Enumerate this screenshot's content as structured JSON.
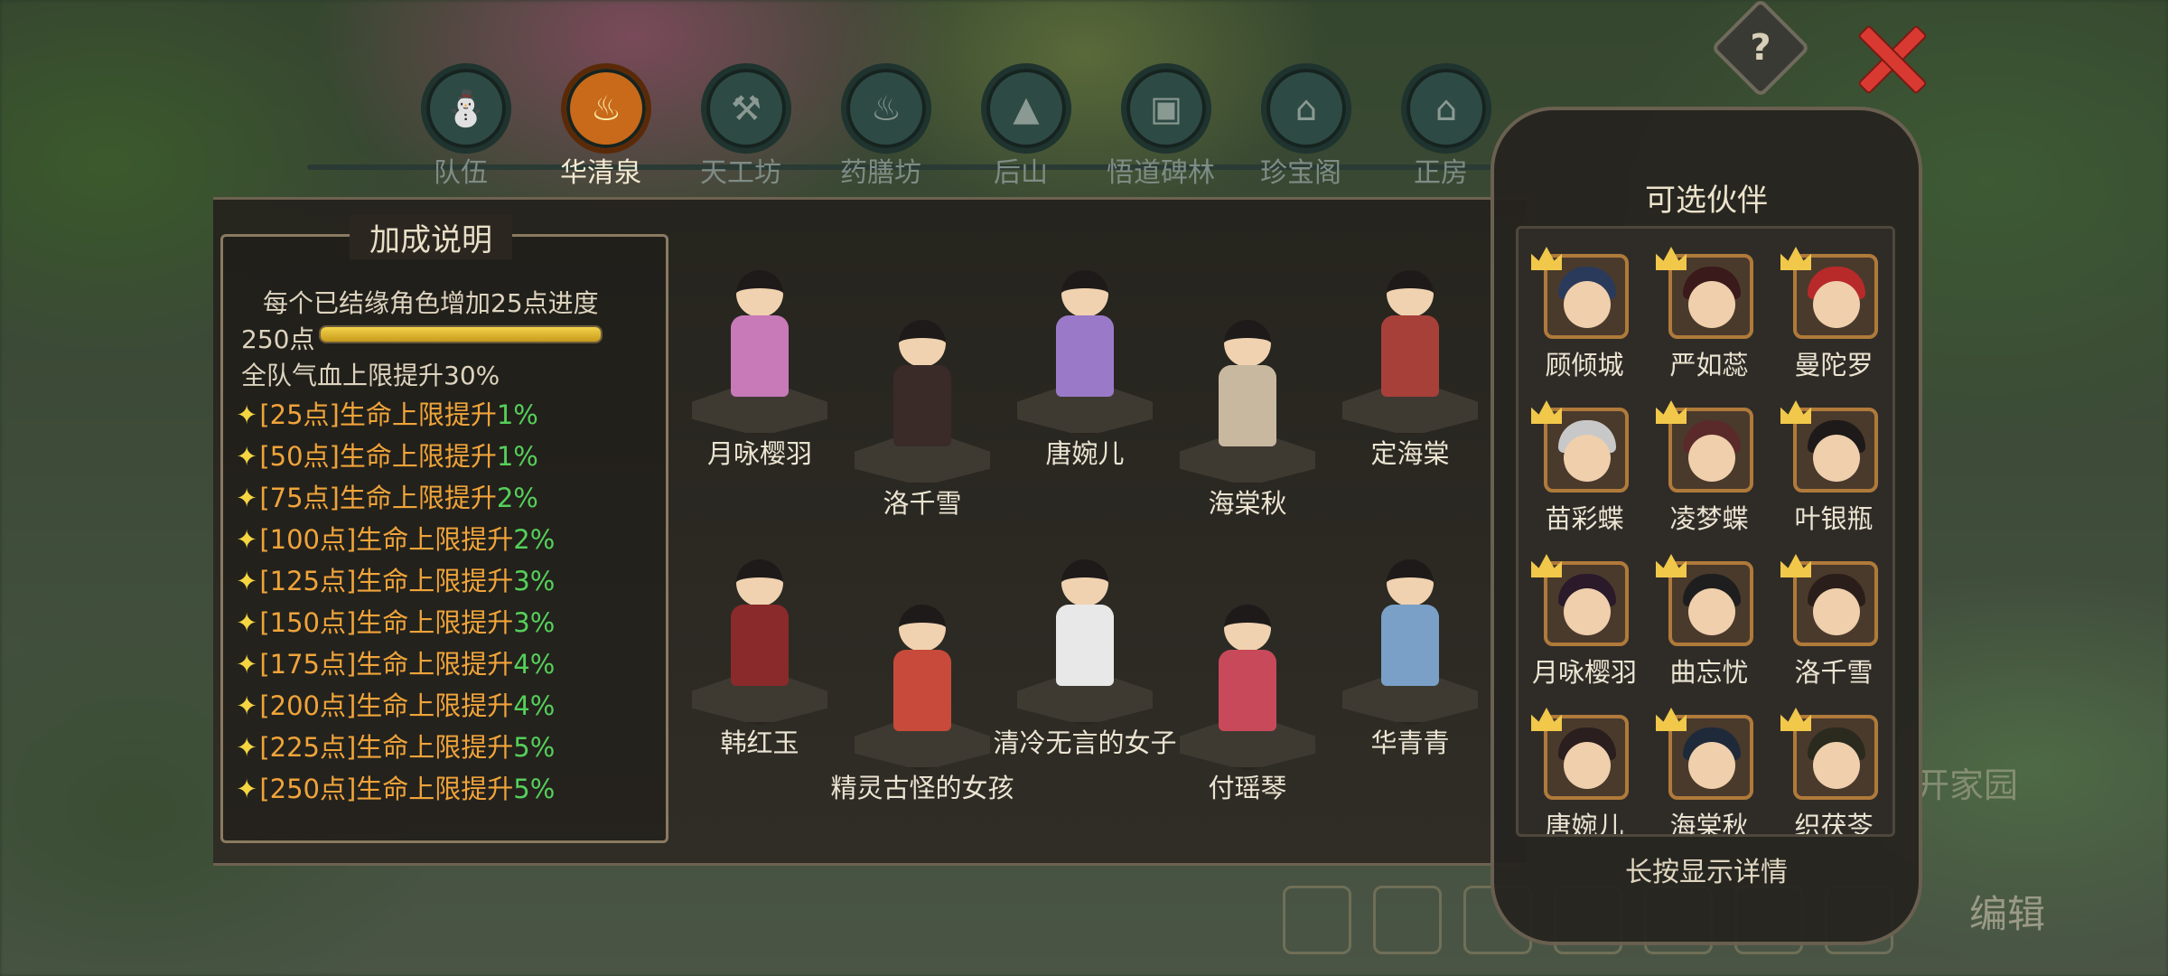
{
  "top": {
    "help_label": "?"
  },
  "tabs": [
    {
      "label": "队伍",
      "icon": "party-icon",
      "active": false
    },
    {
      "label": "华清泉",
      "icon": "hot-spring-icon",
      "active": true
    },
    {
      "label": "天工坊",
      "icon": "workshop-icon",
      "active": false
    },
    {
      "label": "药膳坊",
      "icon": "kitchen-icon",
      "active": false
    },
    {
      "label": "后山",
      "icon": "mountain-icon",
      "active": false
    },
    {
      "label": "悟道碑林",
      "icon": "stele-icon",
      "active": false
    },
    {
      "label": "珍宝阁",
      "icon": "pavilion-icon",
      "active": false
    },
    {
      "label": "正房",
      "icon": "main-hall-icon",
      "active": false
    }
  ],
  "bonus": {
    "title": "加成说明",
    "description": "每个已结缘角色增加25点进度",
    "points_label": "250点",
    "progress": 1.0,
    "team_bonus": "全队气血上限提升30%",
    "levels": [
      {
        "text": "[25点]生命上限提升",
        "pct": "1%"
      },
      {
        "text": "[50点]生命上限提升",
        "pct": "1%"
      },
      {
        "text": "[75点]生命上限提升",
        "pct": "2%"
      },
      {
        "text": "[100点]生命上限提升",
        "pct": "2%"
      },
      {
        "text": "[125点]生命上限提升",
        "pct": "3%"
      },
      {
        "text": "[150点]生命上限提升",
        "pct": "3%"
      },
      {
        "text": "[175点]生命上限提升",
        "pct": "4%"
      },
      {
        "text": "[200点]生命上限提升",
        "pct": "4%"
      },
      {
        "text": "[225点]生命上限提升",
        "pct": "5%"
      },
      {
        "text": "[250点]生命上限提升",
        "pct": "5%"
      }
    ]
  },
  "characters": [
    {
      "name": "月咏樱羽",
      "color": "#c87ab8"
    },
    {
      "name": "洛千雪",
      "color": "#3a2a28"
    },
    {
      "name": "唐婉儿",
      "color": "#9a7ac8"
    },
    {
      "name": "海棠秋",
      "color": "#c8b8a0"
    },
    {
      "name": "定海棠",
      "color": "#a8403a"
    },
    {
      "name": "韩红玉",
      "color": "#8a2a2a"
    },
    {
      "name": "精灵古怪的女孩",
      "color": "#c84a3a"
    },
    {
      "name": "清冷无言的女子",
      "color": "#e8e8e8"
    },
    {
      "name": "付瑶琴",
      "color": "#c84a5a"
    },
    {
      "name": "华青青",
      "color": "#7aa0c8"
    }
  ],
  "companions": {
    "title": "可选伙伴",
    "hint": "长按显示详情",
    "items": [
      {
        "name": "顾倾城",
        "hair": "#2a3a5a"
      },
      {
        "name": "严如蕊",
        "hair": "#3a1a1a"
      },
      {
        "name": "曼陀罗",
        "hair": "#b82a2a"
      },
      {
        "name": "苗彩蝶",
        "hair": "#c8c8c8"
      },
      {
        "name": "凌梦蝶",
        "hair": "#5a2a2a"
      },
      {
        "name": "叶银瓶",
        "hair": "#1e1a1a"
      },
      {
        "name": "月咏樱羽",
        "hair": "#2a1a2a"
      },
      {
        "name": "曲忘忧",
        "hair": "#1e1e1e"
      },
      {
        "name": "洛千雪",
        "hair": "#2a1e1a"
      },
      {
        "name": "唐婉儿",
        "hair": "#2a1e1e"
      },
      {
        "name": "海棠秋",
        "hair": "#1e2a3a"
      },
      {
        "name": "织茯苓",
        "hair": "#2a2a1e"
      }
    ]
  },
  "background": {
    "open_home": "开家园",
    "edit": "编辑"
  }
}
